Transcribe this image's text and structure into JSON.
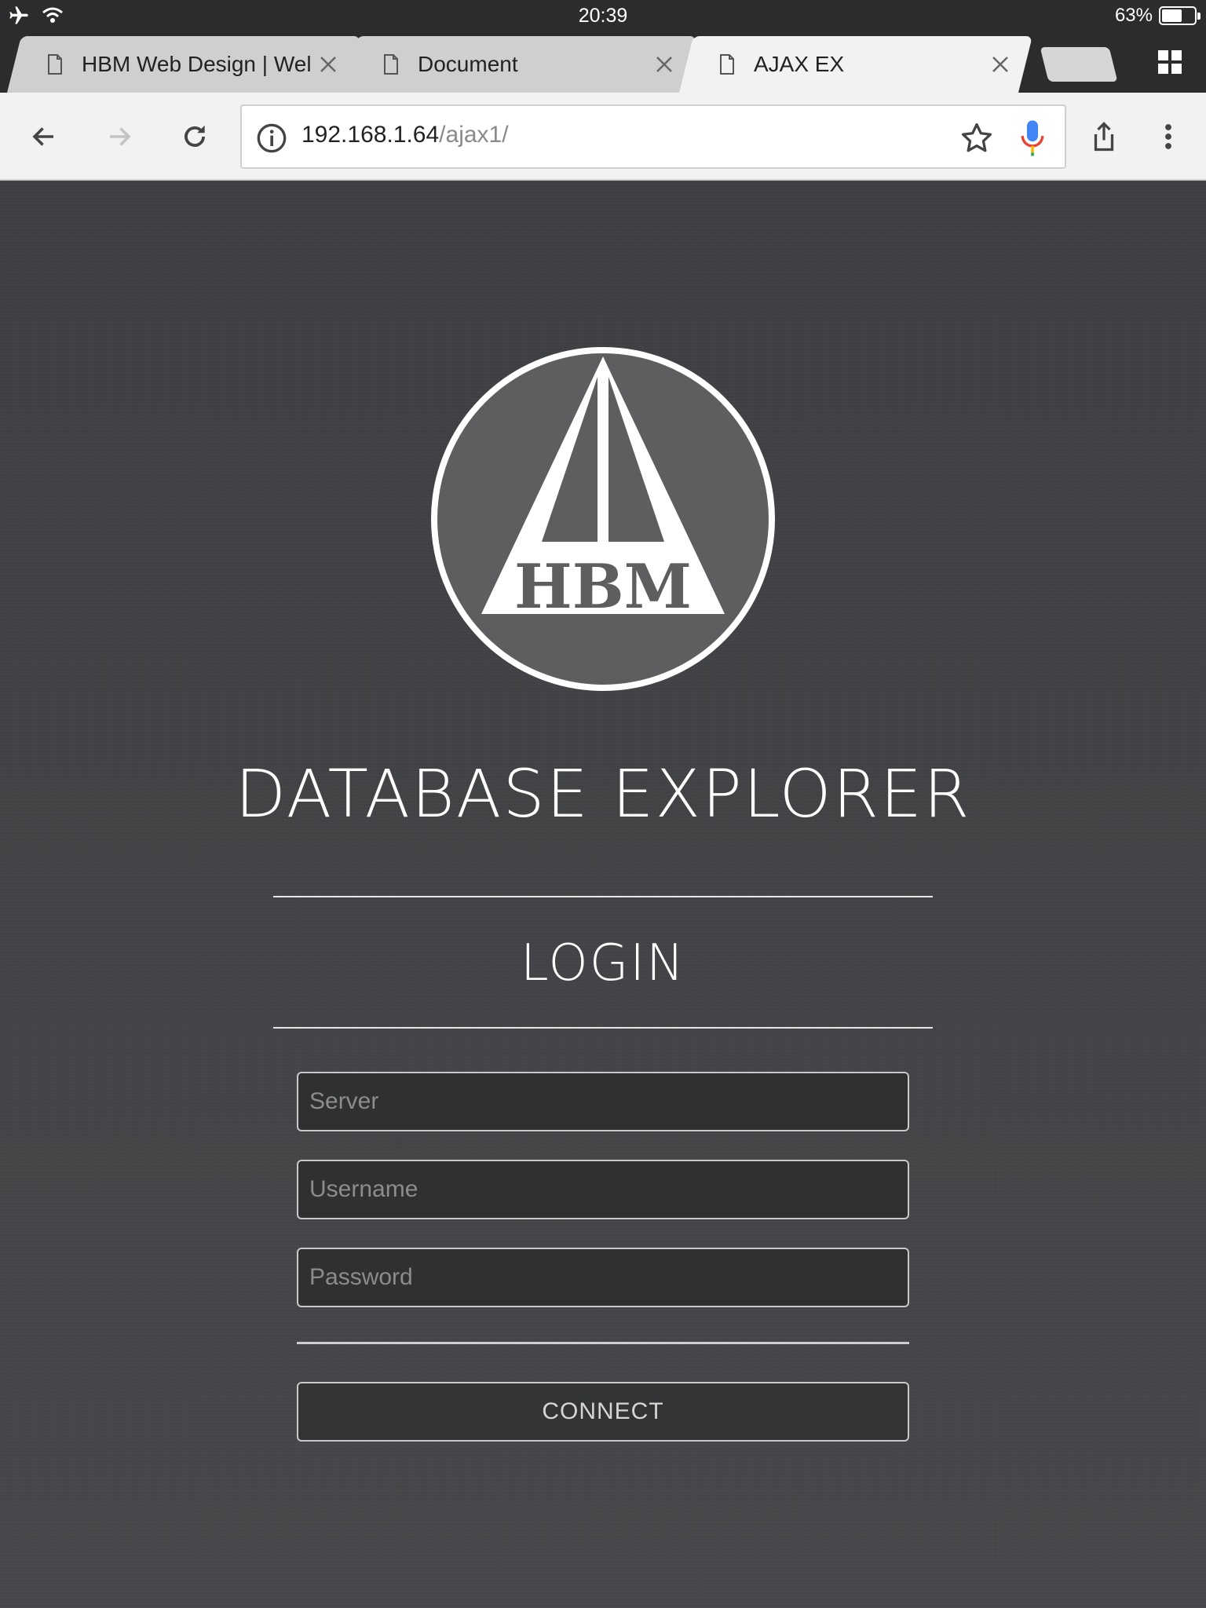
{
  "status_bar": {
    "time": "20:39",
    "battery_text": "63%",
    "battery_level": 0.63,
    "icons": [
      "airplane-icon",
      "wifi-icon",
      "battery-icon"
    ]
  },
  "tabs": [
    {
      "title": "HBM Web Design | Welc",
      "active": false
    },
    {
      "title": "Document",
      "active": false
    },
    {
      "title": "AJAX EX",
      "active": true
    }
  ],
  "toolbar": {
    "url_host": "192.168.1.64",
    "url_path": "/ajax1/",
    "icons": [
      "back-icon",
      "forward-icon",
      "reload-icon",
      "info-icon",
      "star-icon",
      "mic-icon",
      "share-icon",
      "more-icon"
    ]
  },
  "page": {
    "logo_text": "HBM",
    "app_title": "DATABASE EXPLORER",
    "login_title": "LOGIN",
    "server_placeholder": "Server",
    "username_placeholder": "Username",
    "password_placeholder": "Password",
    "connect_label": "CONNECT"
  },
  "colors": {
    "page_background": "#404144",
    "chrome_dark": "#2b2c2e",
    "toolbar": "#f2f2f2",
    "text_light": "#ffffff",
    "logo_fill": "#5f5f61"
  }
}
